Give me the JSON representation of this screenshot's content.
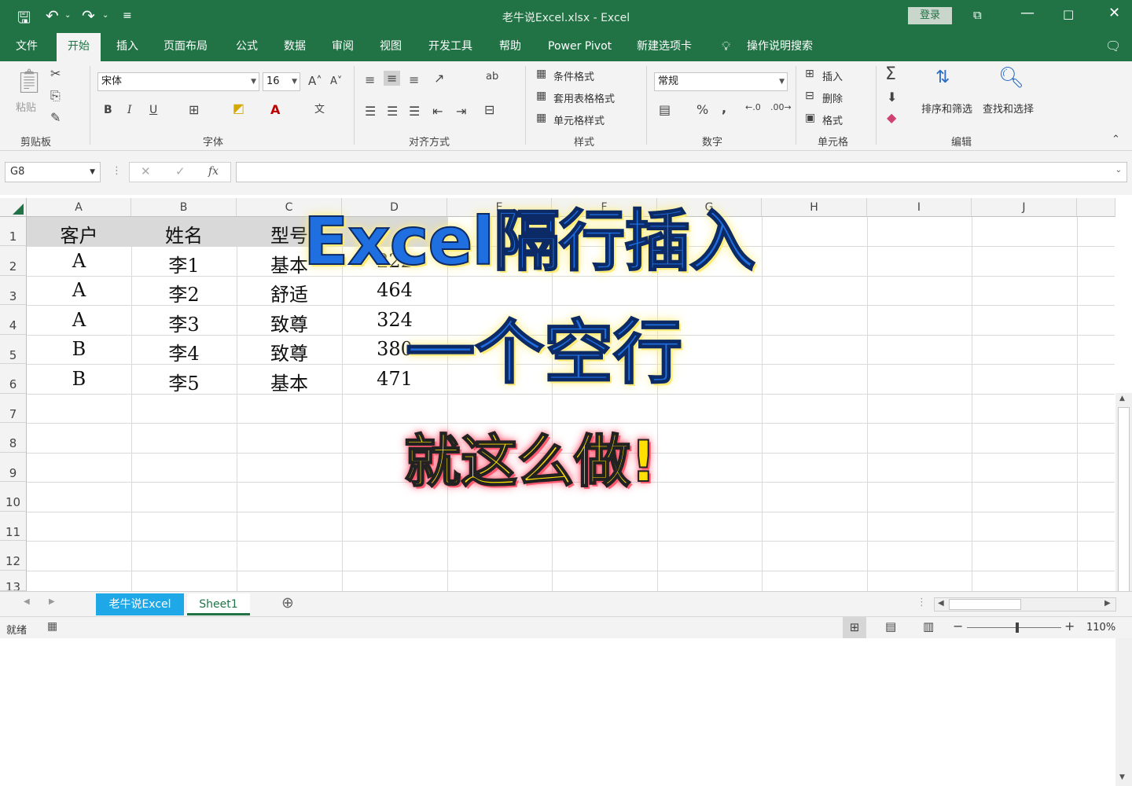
{
  "titlebar": {
    "title": "老牛说Excel.xlsx  -  Excel",
    "login": "登录",
    "icons": [
      "save-icon",
      "undo-icon",
      "redo-icon",
      "customize-qa-icon",
      "ribbon-display-icon",
      "minimize-icon",
      "restore-icon",
      "close-icon"
    ]
  },
  "tabs": [
    "文件",
    "开始",
    "插入",
    "页面布局",
    "公式",
    "数据",
    "审阅",
    "视图",
    "开发工具",
    "帮助",
    "Power Pivot",
    "新建选项卡",
    "操作说明搜索"
  ],
  "ribbon": {
    "clipboard": {
      "paste": "粘贴",
      "label": "剪贴板"
    },
    "font": {
      "name": "宋体",
      "size": "16",
      "label": "字体",
      "bold": "B",
      "italic": "I",
      "underline": "U"
    },
    "alignment": {
      "label": "对齐方式"
    },
    "styles": {
      "conditional": "条件格式",
      "table": "套用表格格式",
      "cell": "单元格样式",
      "label": "样式"
    },
    "number": {
      "format": "常规",
      "percent": "%",
      "comma": ",",
      "label": "数字"
    },
    "cells": {
      "insert": "插入",
      "delete": "删除",
      "format": "格式",
      "label": "单元格"
    },
    "editing": {
      "sort": "排序和筛选",
      "find": "查找和选择",
      "label": "编辑"
    }
  },
  "formula_bar": {
    "name_box": "G8",
    "fx": "fx"
  },
  "columns": [
    "A",
    "B",
    "C",
    "D",
    "E",
    "F",
    "G",
    "H",
    "I",
    "J"
  ],
  "rows": [
    "1",
    "2",
    "3",
    "4",
    "5",
    "6",
    "7",
    "8",
    "9",
    "10",
    "11",
    "12",
    "13"
  ],
  "table": {
    "headers": [
      "客户",
      "姓名",
      "型号",
      ""
    ],
    "rows": [
      [
        "A",
        "李1",
        "基本",
        "222"
      ],
      [
        "A",
        "李2",
        "舒适",
        "464"
      ],
      [
        "A",
        "李3",
        "致尊",
        "324"
      ],
      [
        "B",
        "李4",
        "致尊",
        "380"
      ],
      [
        "B",
        "李5",
        "基本",
        "471"
      ]
    ]
  },
  "overlay": {
    "line1": "Excel隔行插入",
    "line2": "一个空行",
    "line3": "就这么做!"
  },
  "sheets": {
    "active": "老牛说Excel",
    "other": "Sheet1"
  },
  "status": {
    "ready": "就绪",
    "zoom": "110%"
  },
  "colors": {
    "excel_green": "#217346",
    "active_sheet_tab": "#1fa8e8",
    "overlay_blue": "#1f6fe0",
    "overlay_yellow": "#ffe000"
  }
}
